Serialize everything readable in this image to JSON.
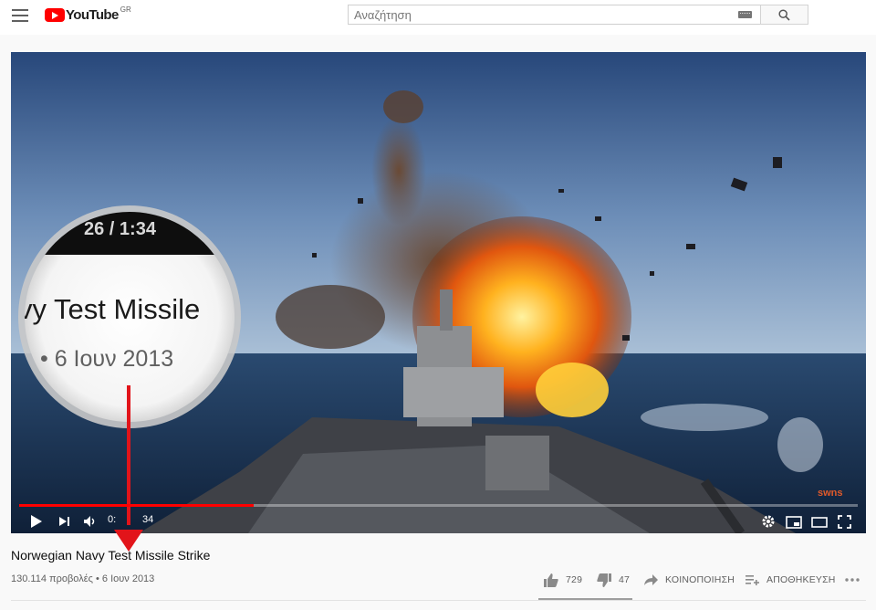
{
  "header": {
    "logo_text": "YouTube",
    "region": "GR",
    "search_placeholder": "Αναζήτηση"
  },
  "player": {
    "time_visible": "0:",
    "time_visible_end": "34",
    "watermark": "swns",
    "progress_fraction": 0.28
  },
  "magnifier": {
    "time_text": "26 / 1:34",
    "title_snippet": "vy Test Missile",
    "date_snippet": "• 6 Ιουν 2013"
  },
  "video": {
    "title": "Norwegian Navy Test Missile Strike",
    "views": "130.114 προβολές",
    "separator": "•",
    "date": "6 Ιουν 2013"
  },
  "actions": {
    "likes": "729",
    "dislikes": "47",
    "share": "ΚΟΙΝΟΠΟΙΗΣΗ",
    "save": "ΑΠΟΘΗΚΕΥΣΗ",
    "like_ratio": 0.94
  },
  "colors": {
    "brand": "#ff0000",
    "annotation": "#e2141a",
    "progress": "#ff0000"
  }
}
